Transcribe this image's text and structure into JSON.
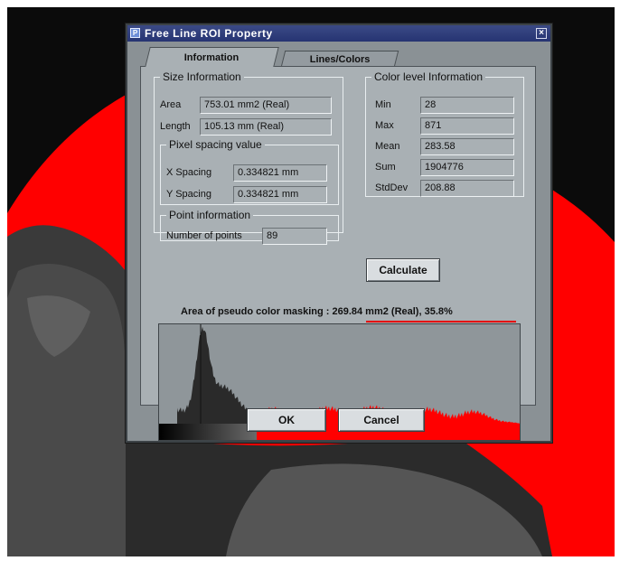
{
  "window": {
    "title": "Free Line ROI Property",
    "icon": "window-icon",
    "close": "×"
  },
  "tabs": [
    {
      "label": "Information",
      "active": true
    },
    {
      "label": "Lines/Colors",
      "active": false
    }
  ],
  "size_info": {
    "legend": "Size Information",
    "area_label": "Area",
    "area_value": "753.01 mm2 (Real)",
    "length_label": "Length",
    "length_value": "105.13 mm (Real)"
  },
  "pixel_spacing": {
    "legend": "Pixel spacing value",
    "x_label": "X Spacing",
    "x_value": "0.334821 mm",
    "y_label": "Y Spacing",
    "y_value": "0.334821 mm"
  },
  "point_info": {
    "legend": "Point information",
    "count_label": "Number of points",
    "count_value": "89"
  },
  "color_level": {
    "legend": "Color level Information",
    "rows": [
      {
        "label": "Min",
        "value": "28"
      },
      {
        "label": "Max",
        "value": "871"
      },
      {
        "label": "Mean",
        "value": "283.58"
      },
      {
        "label": "Sum",
        "value": "1904776"
      },
      {
        "label": "StdDev",
        "value": "208.88"
      }
    ]
  },
  "calculate_label": "Calculate",
  "masking": {
    "text": "Area of pseudo color masking : 269.84 mm2 (Real), 35.8%",
    "threshold_fraction": 0.27
  },
  "buttons": {
    "ok": "OK",
    "cancel": "Cancel"
  },
  "colors": {
    "mask": "#ff0000",
    "title_bar": "#263472",
    "dialog": "#8a9195"
  }
}
